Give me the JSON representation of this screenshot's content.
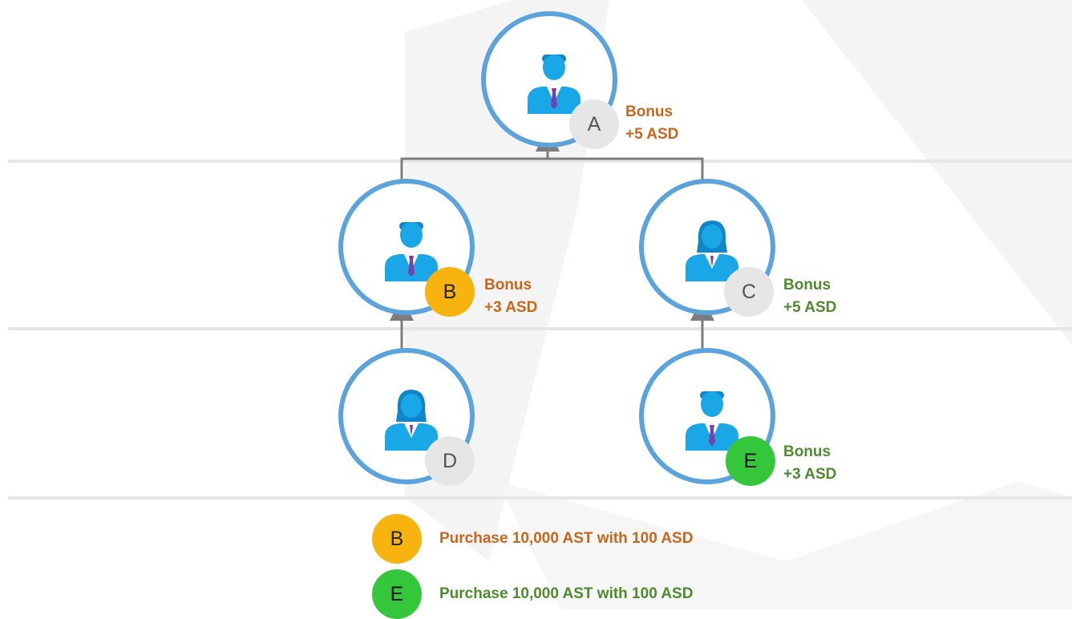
{
  "colors": {
    "orange": "#c8661c",
    "green": "#4f8a2f",
    "ring": "#5ba3dc",
    "badge_gray": "#e6e6e6",
    "badge_yellow": "#f8b40e",
    "badge_green": "#34c73b",
    "connector": "#7d7d7d"
  },
  "nodes": {
    "a": {
      "badge": "A",
      "avatar": "male-user-icon",
      "bonus_line1": "Bonus",
      "bonus_line2": "+5 ASD"
    },
    "b": {
      "badge": "B",
      "avatar": "male-user-icon",
      "bonus_line1": "Bonus",
      "bonus_line2": "+3 ASD"
    },
    "c": {
      "badge": "C",
      "avatar": "female-user-icon",
      "bonus_line1": "Bonus",
      "bonus_line2": "+5 ASD"
    },
    "d": {
      "badge": "D",
      "avatar": "female-user-icon"
    },
    "e": {
      "badge": "E",
      "avatar": "male-user-icon",
      "bonus_line1": "Bonus",
      "bonus_line2": "+3 ASD"
    }
  },
  "legend": [
    {
      "badge": "B",
      "text": "Purchase 10,000 AST with 100 ASD"
    },
    {
      "badge": "E",
      "text": "Purchase 10,000 AST with 100 ASD"
    }
  ]
}
